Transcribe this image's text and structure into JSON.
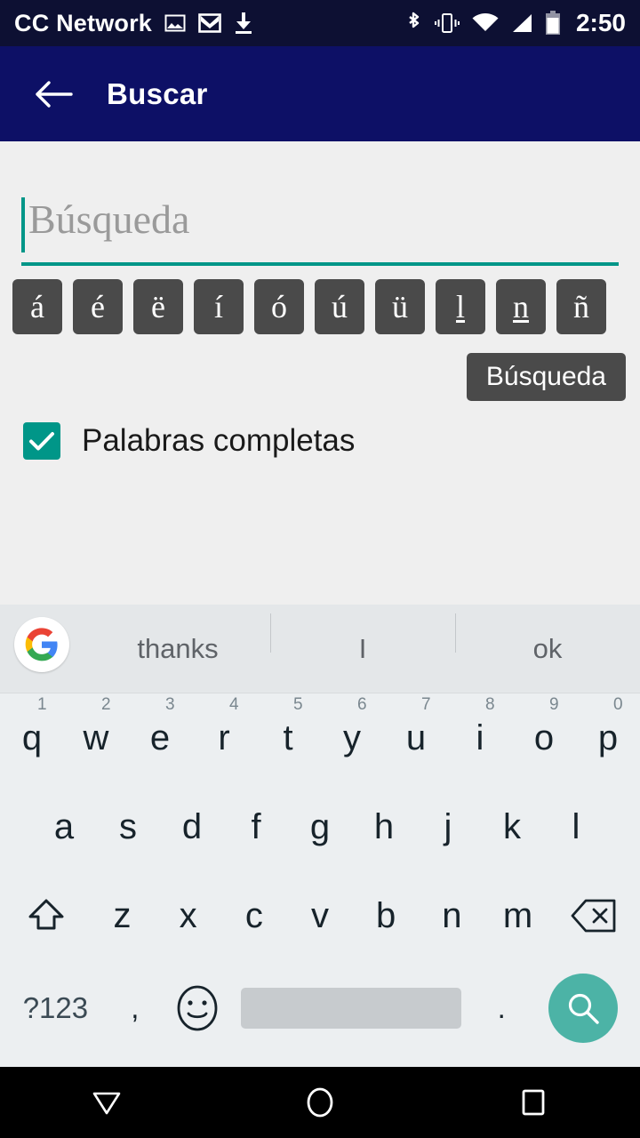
{
  "status_bar": {
    "carrier": "CC Network",
    "time": "2:50",
    "left_icons": [
      "image-icon",
      "gmail-icon",
      "download-icon"
    ],
    "right_icons": [
      "bluetooth-icon",
      "vibrate-icon",
      "wifi-icon",
      "signal-icon",
      "battery-icon"
    ],
    "background": "#0d1033"
  },
  "app_bar": {
    "title": "Buscar",
    "back_icon": "arrow-back-icon",
    "background": "#0d1066"
  },
  "search": {
    "placeholder": "Búsqueda",
    "value": "",
    "accent_color": "#009688"
  },
  "accent_keys": [
    {
      "label": "á",
      "underline": false
    },
    {
      "label": "é",
      "underline": false
    },
    {
      "label": "ë",
      "underline": false
    },
    {
      "label": "í",
      "underline": false
    },
    {
      "label": "ó",
      "underline": false
    },
    {
      "label": "ú",
      "underline": false
    },
    {
      "label": "ü",
      "underline": false
    },
    {
      "label": "l",
      "underline": true
    },
    {
      "label": "n",
      "underline": true
    },
    {
      "label": "ñ",
      "underline": false
    }
  ],
  "tooltip": {
    "text": "Búsqueda"
  },
  "checkbox": {
    "label": "Palabras completas",
    "checked": true,
    "color": "#009688"
  },
  "keyboard": {
    "suggestions": [
      "thanks",
      "I",
      "ok"
    ],
    "logo": "google-g-icon",
    "row1": [
      {
        "key": "q",
        "hint": "1"
      },
      {
        "key": "w",
        "hint": "2"
      },
      {
        "key": "e",
        "hint": "3"
      },
      {
        "key": "r",
        "hint": "4"
      },
      {
        "key": "t",
        "hint": "5"
      },
      {
        "key": "y",
        "hint": "6"
      },
      {
        "key": "u",
        "hint": "7"
      },
      {
        "key": "i",
        "hint": "8"
      },
      {
        "key": "o",
        "hint": "9"
      },
      {
        "key": "p",
        "hint": "0"
      }
    ],
    "row2": [
      "a",
      "s",
      "d",
      "f",
      "g",
      "h",
      "j",
      "k",
      "l"
    ],
    "row3": [
      "z",
      "x",
      "c",
      "v",
      "b",
      "n",
      "m"
    ],
    "shift_icon": "shift-icon",
    "backspace_icon": "backspace-icon",
    "symbols_key": "?123",
    "comma_key": ",",
    "emoji_icon": "emoji-icon",
    "period_key": ".",
    "search_icon": "search-icon",
    "search_key_color": "#4cb3a6"
  },
  "nav_bar": {
    "back_icon": "keyboard-collapse-icon",
    "home_icon": "home-circle-icon",
    "recents_icon": "recents-square-icon"
  }
}
